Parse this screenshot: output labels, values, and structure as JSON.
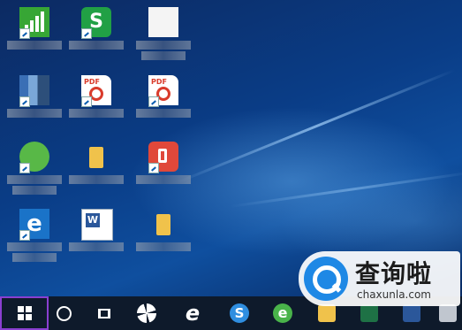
{
  "watermark": {
    "title": "查询啦",
    "url": "chaxunla.com"
  },
  "desktop": {
    "icons": [
      {
        "name": "green-bars-app-icon"
      },
      {
        "name": "green-s-app-icon"
      },
      {
        "name": "white-file-icon"
      },
      {
        "name": "mosaic-app-icon"
      },
      {
        "name": "pdf-file-icon"
      },
      {
        "name": "pdf-file-icon-2"
      },
      {
        "name": "green-round-app-icon"
      },
      {
        "name": "folder-icon"
      },
      {
        "name": "foxit-reader-icon"
      },
      {
        "name": "edge-browser-icon",
        "glyph": "e"
      },
      {
        "name": "word-document-icon"
      },
      {
        "name": "folder-icon-2"
      }
    ]
  },
  "taskbar": {
    "edge_glyph": "e",
    "sogou_glyph": "S",
    "browser360_glyph": "e",
    "colors": {
      "start_highlight": "#8a3fd1",
      "background": "#0e1a2b"
    }
  }
}
